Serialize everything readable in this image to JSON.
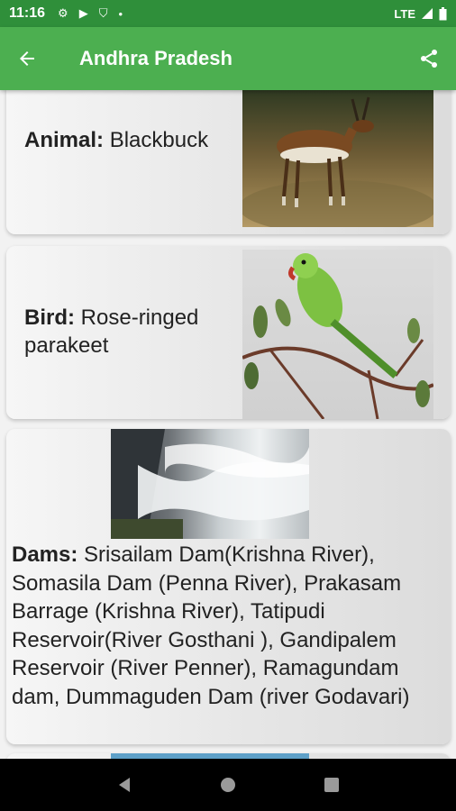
{
  "status_bar": {
    "time": "11:16",
    "network": "LTE",
    "icons": [
      "gear-icon",
      "play-icon",
      "shield-icon",
      "dot-icon"
    ]
  },
  "app_bar": {
    "title": "Andhra Pradesh",
    "back_icon": "arrow-left-icon",
    "share_icon": "share-icon"
  },
  "cards": {
    "animal": {
      "label": "Animal:",
      "value": "Blackbuck"
    },
    "bird": {
      "label": "Bird:",
      "value": "Rose-ringed parakeet"
    },
    "dams": {
      "label": "Dams:",
      "value": "Srisailam Dam(Krishna River), Somasila Dam (Penna River), Prakasam Barrage (Krishna River), Tatipudi Reservoir(River Gosthani ), Gandipalem Reservoir (River Penner), Ramagundam dam, Dummaguden Dam (river Godavari)"
    }
  },
  "colors": {
    "app_bar": "#4caf50",
    "status_bar": "#2f8f3a"
  }
}
